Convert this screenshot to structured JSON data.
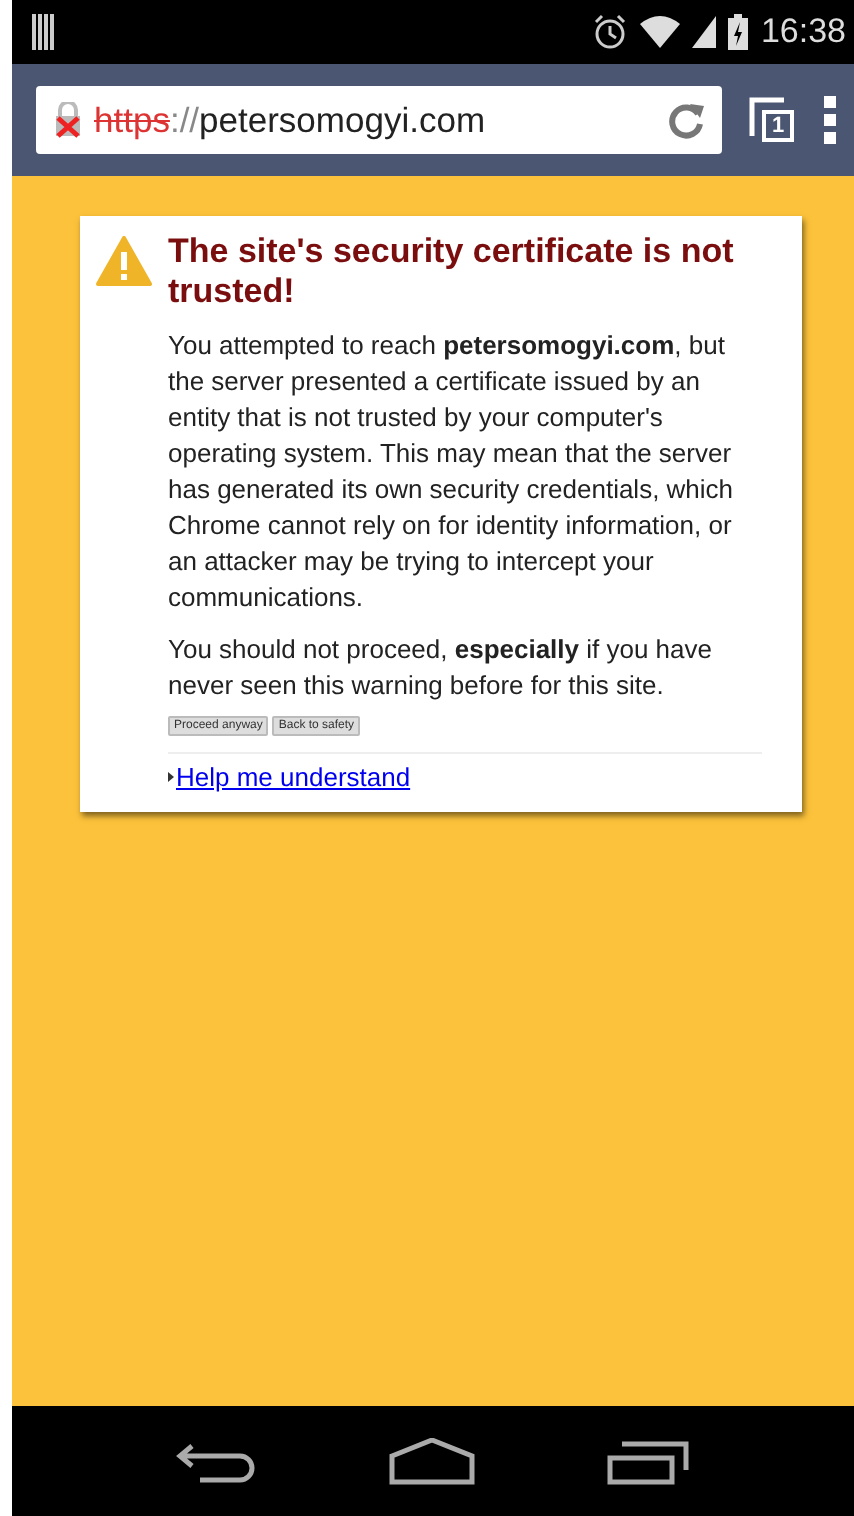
{
  "status_bar": {
    "time": "16:38"
  },
  "toolbar": {
    "url": {
      "scheme": "https",
      "separator": "://",
      "host": "petersomogyi.com",
      "insecure": true
    },
    "tab_count": "1"
  },
  "warning": {
    "title": "The site's security certificate is not trusted!",
    "paragraphs": [
      "You attempted to reach **petersomogyi.com**, but the server presented a certificate issued by an entity that is not trusted by your computer's operating system. This may mean that the server has generated its own security credentials, which Chrome cannot rely on for identity information, or an attacker may be trying to intercept your communications.",
      "You should not proceed, **especially** if you have never seen this warning before for this site."
    ],
    "buttons": [
      "Proceed anyway",
      "Back to safety"
    ],
    "link": "Help me understand"
  }
}
